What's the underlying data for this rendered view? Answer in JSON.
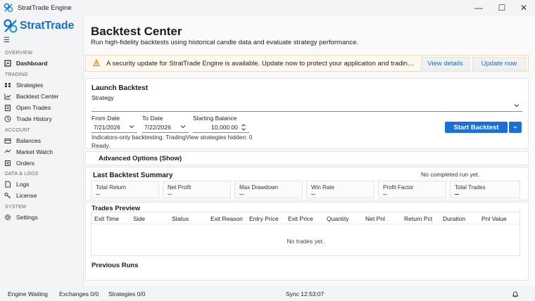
{
  "window": {
    "title": "StratTrade Engine",
    "minimize": "—",
    "maximize": "☐",
    "close": "✕"
  },
  "brand": {
    "name": "StratTrade",
    "accent": "#1a6fc4"
  },
  "sidebar": {
    "menu_icon": "☰",
    "sections": [
      {
        "label": "OVERVIEW",
        "items": [
          {
            "label": "Dashboard",
            "icon": "dashboard-icon",
            "active": true
          }
        ]
      },
      {
        "label": "TRADING",
        "items": [
          {
            "label": "Strategies",
            "icon": "strategies-icon"
          },
          {
            "label": "Backtest Center",
            "icon": "chart-icon"
          },
          {
            "label": "Open Trades",
            "icon": "clipboard-icon"
          },
          {
            "label": "Trade History",
            "icon": "clock-icon"
          }
        ]
      },
      {
        "label": "ACCOUNT",
        "items": [
          {
            "label": "Balances",
            "icon": "wallet-icon"
          },
          {
            "label": "Market Watch",
            "icon": "eye-icon"
          },
          {
            "label": "Orders",
            "icon": "list-icon"
          }
        ]
      },
      {
        "label": "DATA & LOGS",
        "items": [
          {
            "label": "Logs",
            "icon": "document-icon"
          },
          {
            "label": "License",
            "icon": "key-icon"
          }
        ]
      },
      {
        "label": "SYSTEM",
        "items": [
          {
            "label": "Settings",
            "icon": "gear-icon"
          }
        ]
      }
    ]
  },
  "header": {
    "title": "Backtest Center",
    "subtitle": "Run high-fidelity backtests using historical candle data and evaluate strategy performance."
  },
  "banner": {
    "message": "A security update for StratTrade Engine is available. Update now to protect your application and trading environment.",
    "details_label": "View details",
    "update_label": "Update now",
    "warn_color": "#e08a1e"
  },
  "launch": {
    "title": "Launch Backtest",
    "strategy_label": "Strategy",
    "strategy_value": "",
    "from_label": "From Date",
    "from_value": "7/21/2026",
    "to_label": "To Date",
    "to_value": "7/22/2026",
    "balance_label": "Starting Balance",
    "balance_value": "10,000.00",
    "start_label": "Start Backtest",
    "start_color": "#1a6fd8",
    "info": "Indicators-only backtesting. TradingView strategies hidden: 0",
    "status": "Ready."
  },
  "advanced": {
    "label": "Advanced Options (Show)"
  },
  "summary": {
    "title": "Last Backtest Summary",
    "note": "No completed run yet.",
    "cards": [
      {
        "label": "Total Return",
        "value": "--",
        "color": "#2aa052"
      },
      {
        "label": "Net Profit",
        "value": "--",
        "color": "#2aa052"
      },
      {
        "label": "Max Drawdown",
        "value": "--",
        "color": "#d83b3b"
      },
      {
        "label": "Win Rate",
        "value": "--",
        "color": "#2b6fd6"
      },
      {
        "label": "Profit Factor",
        "value": "--",
        "color": "#2aa052"
      },
      {
        "label": "Total Trades",
        "value": "--",
        "color": "#222222"
      }
    ]
  },
  "trades": {
    "title": "Trades Preview",
    "columns": [
      "Exit Time",
      "Side",
      "Status",
      "Exit Reason",
      "Entry Price",
      "Exit Price",
      "Quantity",
      "Net Pnl",
      "Return Pct",
      "Duration",
      "Pnl Value"
    ],
    "empty": "No trades yet."
  },
  "previous": {
    "title": "Previous Runs"
  },
  "statusbar": {
    "engine": "Engine Waiting",
    "exchanges": "Exchanges 0/0",
    "strategies": "Strategies 0/0",
    "sync": "Sync 12:53:07",
    "bell_icon": "bell-icon"
  }
}
